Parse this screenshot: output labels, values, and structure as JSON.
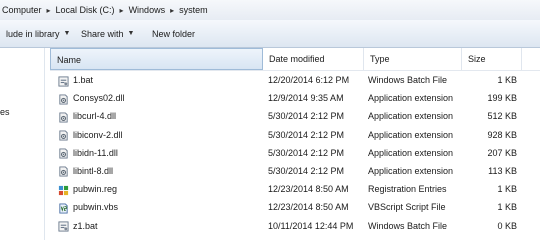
{
  "breadcrumb": [
    "Computer",
    "Local Disk (C:)",
    "Windows",
    "system"
  ],
  "breadcrumb_sep": "▸",
  "toolbar": {
    "include_label": "lude in library",
    "share_label": "Share with",
    "new_folder_label": "New folder",
    "dropdown_glyph": "▼"
  },
  "nav": {
    "partial_label": "es"
  },
  "columns": {
    "name": "Name",
    "date": "Date modified",
    "type": "Type",
    "size": "Size"
  },
  "files": [
    {
      "name": "1.bat",
      "date": "12/20/2014 6:12 PM",
      "type": "Windows Batch File",
      "size": "1 KB",
      "icon": "batch-file-icon"
    },
    {
      "name": "Consys02.dll",
      "date": "12/9/2014 9:35 AM",
      "type": "Application extension",
      "size": "199 KB",
      "icon": "dll-file-icon"
    },
    {
      "name": "libcurl-4.dll",
      "date": "5/30/2014 2:12 PM",
      "type": "Application extension",
      "size": "512 KB",
      "icon": "dll-file-icon"
    },
    {
      "name": "libiconv-2.dll",
      "date": "5/30/2014 2:12 PM",
      "type": "Application extension",
      "size": "928 KB",
      "icon": "dll-file-icon"
    },
    {
      "name": "libidn-11.dll",
      "date": "5/30/2014 2:12 PM",
      "type": "Application extension",
      "size": "207 KB",
      "icon": "dll-file-icon"
    },
    {
      "name": "libintl-8.dll",
      "date": "5/30/2014 2:12 PM",
      "type": "Application extension",
      "size": "113 KB",
      "icon": "dll-file-icon"
    },
    {
      "name": "pubwin.reg",
      "date": "12/23/2014 8:50 AM",
      "type": "Registration Entries",
      "size": "1 KB",
      "icon": "registry-file-icon"
    },
    {
      "name": "pubwin.vbs",
      "date": "12/23/2014 8:50 AM",
      "type": "VBScript Script File",
      "size": "1 KB",
      "icon": "vbscript-file-icon"
    },
    {
      "name": "z1.bat",
      "date": "10/11/2014 12:44 PM",
      "type": "Windows Batch File",
      "size": "0 KB",
      "icon": "batch-file-icon"
    }
  ]
}
